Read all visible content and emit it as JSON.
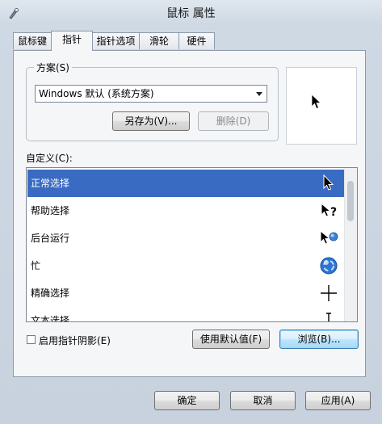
{
  "window": {
    "title": "鼠标 属性"
  },
  "tabs": [
    "鼠标键",
    "指针",
    "指针选项",
    "滑轮",
    "硬件"
  ],
  "scheme": {
    "group_label": "方案(S)",
    "selected": "Windows 默认 (系统方案)",
    "save_as": "另存为(V)...",
    "delete": "删除(D)"
  },
  "customize": {
    "label": "自定义(C):",
    "items": [
      "正常选择",
      "帮助选择",
      "后台运行",
      "忙",
      "精确选择",
      "文本选择"
    ]
  },
  "options": {
    "shadow_label": "启用指针阴影(E)",
    "use_default": "使用默认值(F)",
    "browse": "浏览(B)..."
  },
  "footer": {
    "ok": "确定",
    "cancel": "取消",
    "apply": "应用(A)"
  },
  "colors": {
    "selection": "#3a6bc3",
    "focus_border": "#3c7fb1"
  }
}
